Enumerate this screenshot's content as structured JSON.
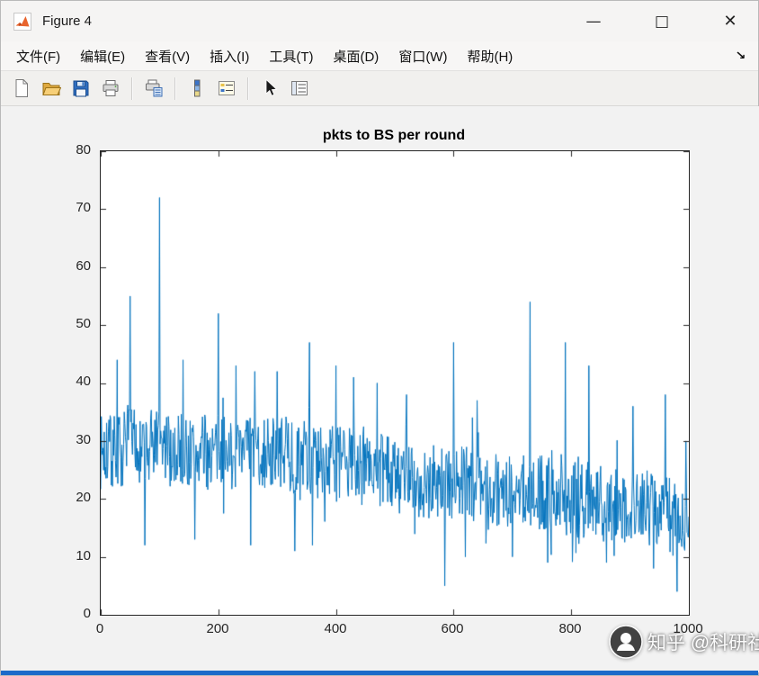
{
  "window": {
    "title": "Figure 4",
    "controls": {
      "minimize": "—",
      "maximize": "□",
      "close": "✕"
    }
  },
  "menubar": {
    "items": [
      "文件(F)",
      "编辑(E)",
      "查看(V)",
      "插入(I)",
      "工具(T)",
      "桌面(D)",
      "窗口(W)",
      "帮助(H)"
    ],
    "dock_arrow": "↘"
  },
  "toolbar": {
    "icons": [
      "new-file-icon",
      "open-file-icon",
      "save-icon",
      "print-icon",
      "print-preview-icon",
      "colorbar-icon",
      "insert-legend-icon",
      "pointer-icon",
      "property-inspector-icon"
    ]
  },
  "watermark": {
    "text": "知乎 @科研社"
  },
  "colors": {
    "line_blue": "#0072BD",
    "axes": "#262626",
    "figure_bg": "#f2f2f2",
    "bottom_strip": "#1b6ac9"
  },
  "chart_data": {
    "type": "line",
    "title": "pkts to BS per round",
    "xlabel": "",
    "ylabel": "",
    "x_range": [
      0,
      1000
    ],
    "y_range": [
      0,
      80
    ],
    "x_ticks": [
      0,
      200,
      400,
      600,
      800,
      1000
    ],
    "y_ticks": [
      0,
      10,
      20,
      30,
      40,
      50,
      60,
      70,
      80
    ],
    "grid": false,
    "legend": "none",
    "line_color": "#0072BD",
    "n_points": 1000,
    "seed": 7,
    "noise_amplitude": 6.5,
    "trend": [
      [
        0,
        28
      ],
      [
        50,
        29
      ],
      [
        100,
        29
      ],
      [
        150,
        28
      ],
      [
        200,
        28
      ],
      [
        250,
        28
      ],
      [
        300,
        28
      ],
      [
        350,
        27
      ],
      [
        400,
        26
      ],
      [
        450,
        26
      ],
      [
        500,
        24
      ],
      [
        550,
        23
      ],
      [
        600,
        23
      ],
      [
        650,
        22
      ],
      [
        700,
        21
      ],
      [
        750,
        21
      ],
      [
        800,
        20
      ],
      [
        850,
        19
      ],
      [
        900,
        19
      ],
      [
        950,
        18
      ],
      [
        1000,
        16
      ]
    ],
    "spikes": [
      [
        28,
        44
      ],
      [
        50,
        55
      ],
      [
        100,
        72
      ],
      [
        140,
        44
      ],
      [
        200,
        52
      ],
      [
        230,
        43
      ],
      [
        262,
        42
      ],
      [
        300,
        42
      ],
      [
        355,
        47
      ],
      [
        400,
        43
      ],
      [
        430,
        41
      ],
      [
        470,
        40
      ],
      [
        520,
        38
      ],
      [
        600,
        47
      ],
      [
        640,
        37
      ],
      [
        730,
        54
      ],
      [
        790,
        47
      ],
      [
        830,
        43
      ],
      [
        905,
        36
      ],
      [
        960,
        38
      ],
      [
        995,
        30
      ]
    ],
    "dips": [
      [
        75,
        12
      ],
      [
        160,
        13
      ],
      [
        255,
        12
      ],
      [
        330,
        11
      ],
      [
        360,
        12
      ],
      [
        585,
        5
      ],
      [
        620,
        10
      ],
      [
        700,
        10
      ],
      [
        760,
        9
      ],
      [
        860,
        9
      ],
      [
        940,
        8
      ],
      [
        980,
        4
      ]
    ]
  }
}
